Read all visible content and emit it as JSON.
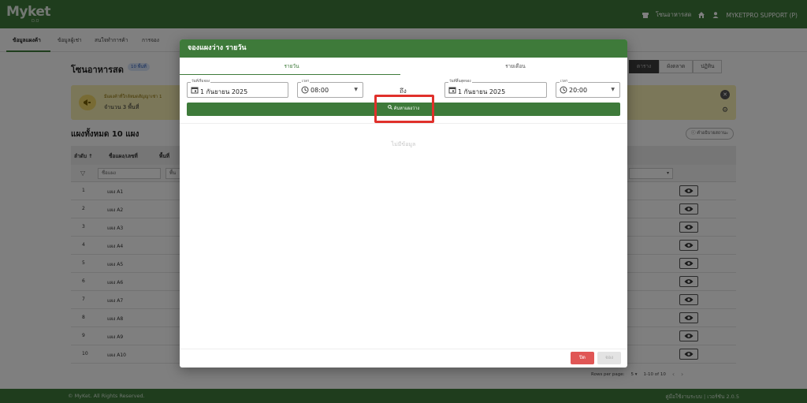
{
  "app": {
    "logo": "Myket",
    "logo_sub": "D.O",
    "zone_name": "โซนอาหารสด",
    "user": "MYKETPRO SUPPORT (P)"
  },
  "nav": {
    "tabs": [
      "ข้อมูลแผงค้า",
      "ข้อมูลผู้เช่า",
      "สนใจทำการค้า",
      "การจอง"
    ]
  },
  "page": {
    "title": "โซนอาหารสด",
    "badge": "10 พื้นที่",
    "view_buttons": [
      "ตาราง",
      "ผังตลาด",
      "ปฏิทิน"
    ]
  },
  "notice": {
    "line1": "มีแผงค้าที่ใกล้หมดสัญญาเช่า 1",
    "line2": "จำนวน 3 พื้นที่"
  },
  "summary": {
    "total": "แผงทั้งหมด 10 แผง",
    "explain": "คำอธิบายสถานะ"
  },
  "table": {
    "headers": {
      "index": "ลำดับ ↑",
      "name": "ชื่อแผง/เลขที่",
      "area": "พื้นที่"
    },
    "filters": {
      "name_placeholder": "ชื่อแผง",
      "area_placeholder": "พื้น"
    },
    "rows": [
      {
        "idx": "1",
        "name": "แผง A1"
      },
      {
        "idx": "2",
        "name": "แผง A2"
      },
      {
        "idx": "3",
        "name": "แผง A3"
      },
      {
        "idx": "4",
        "name": "แผง A4"
      },
      {
        "idx": "5",
        "name": "แผง A5"
      },
      {
        "idx": "6",
        "name": "แผง A6"
      },
      {
        "idx": "7",
        "name": "แผง A7"
      },
      {
        "idx": "8",
        "name": "แผง A8"
      },
      {
        "idx": "9",
        "name": "แผง A9"
      },
      {
        "idx": "10",
        "name": "แผง A10"
      }
    ]
  },
  "pager": {
    "rows_per_page_label": "Rows per page:",
    "rows_per_page": "5",
    "range": "1-10 of 10"
  },
  "footer": {
    "copyright": "© MyKet. All Rights Reserved.",
    "version": "คู่มือใช้งานระบบ | เวอร์ชัน 2.0.5"
  },
  "modal": {
    "title": "จองแผงว่าง รายวัน",
    "tabs": [
      "รายวัน",
      "รายเดือน"
    ],
    "start_date_label": "วันที่เริ่มจอง",
    "start_date": "1 กันยายน 2025",
    "start_time_label": "เวลา",
    "start_time": "08:00",
    "to_label": "ถึง",
    "end_date_label": "วันที่สิ้นสุดจอง",
    "end_date": "1 กันยายน 2025",
    "end_time_label": "เวลา",
    "end_time": "20:00",
    "search_label": "ค้นหาแผงว่าง",
    "no_data": "ไม่มีข้อมูล",
    "close_label": "ปิด",
    "book_label": "จอง"
  },
  "colors": {
    "brand_green": "#3e7a3a",
    "highlight_red": "#e0302b",
    "close_red": "#e05655",
    "notice_yellow": "#f7efb2"
  }
}
